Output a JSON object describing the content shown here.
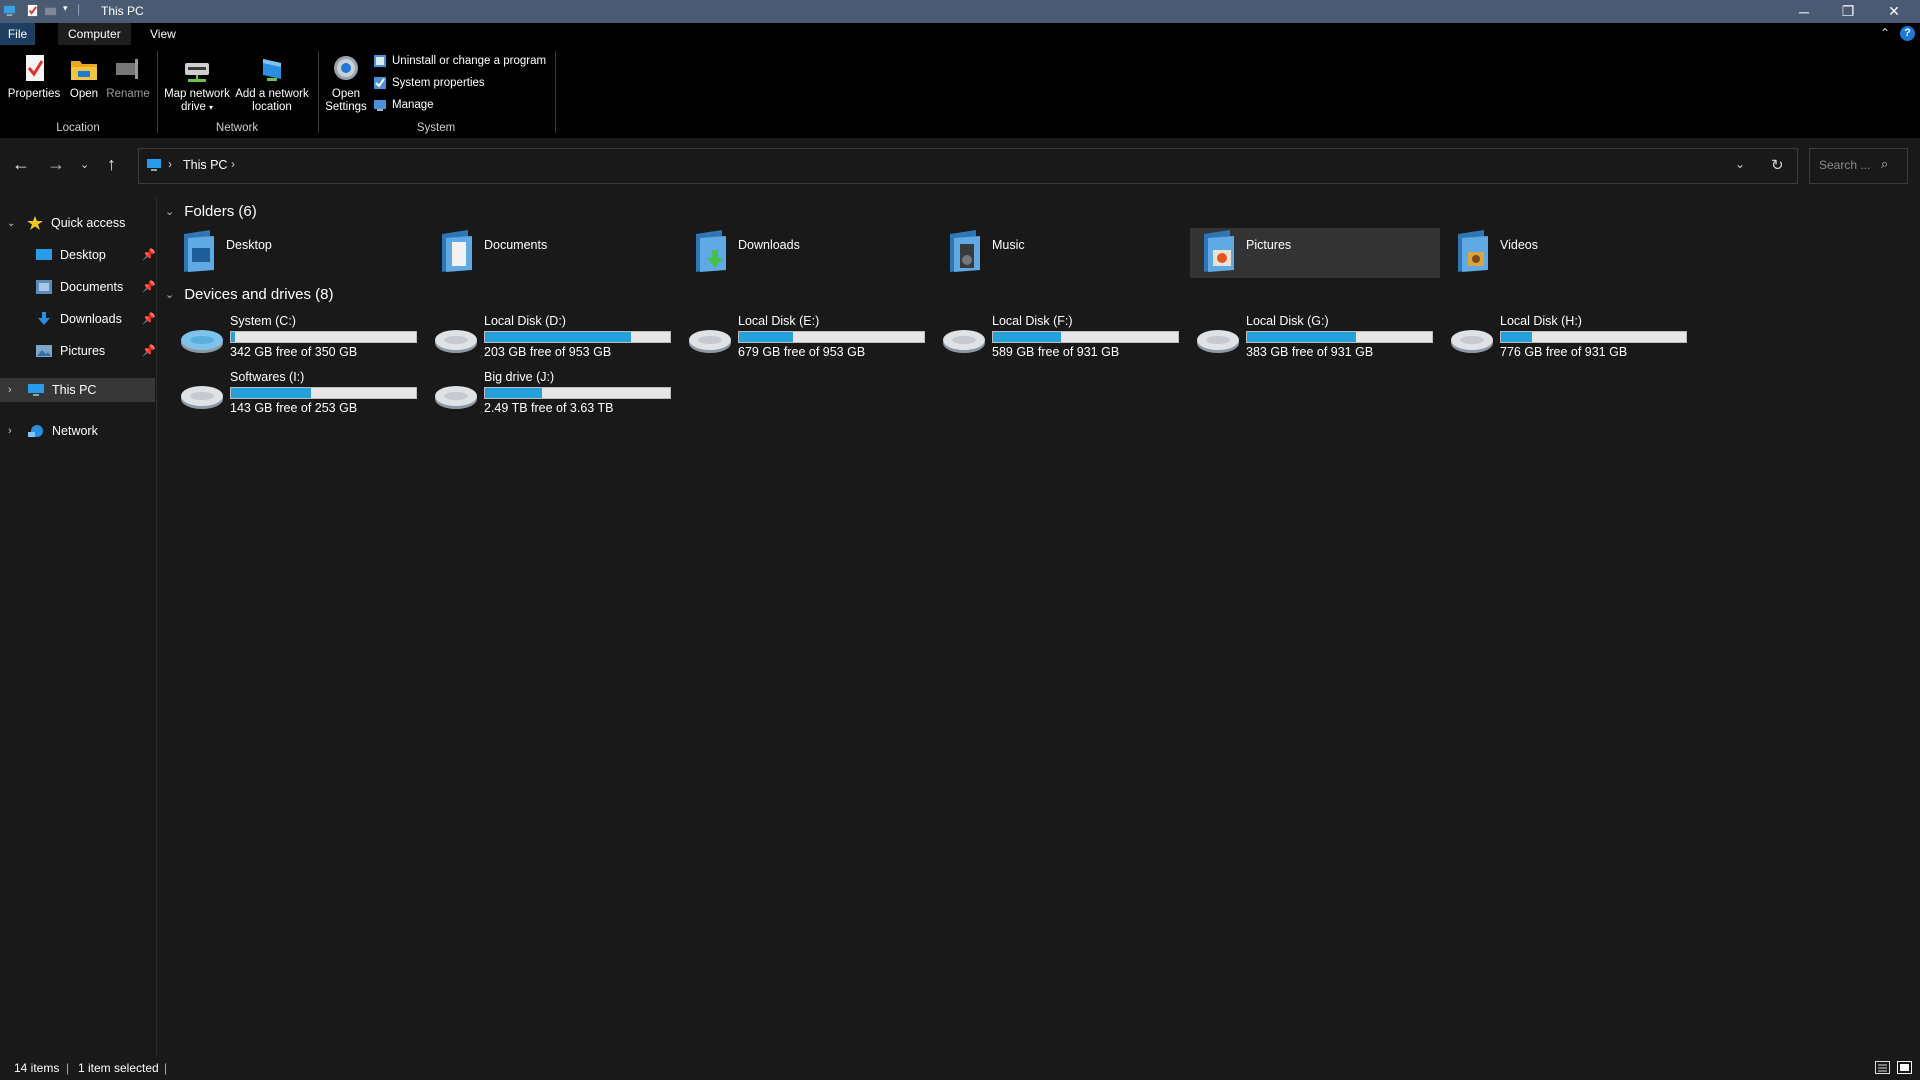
{
  "window": {
    "title": "This PC",
    "controls": [
      "minimize",
      "restore",
      "close"
    ]
  },
  "ribbon": {
    "tabs": [
      {
        "label": "File"
      },
      {
        "label": "Computer",
        "active": true
      },
      {
        "label": "View"
      }
    ],
    "location_group": {
      "label": "Location",
      "buttons": [
        {
          "label": "Properties",
          "icon": "properties-icon"
        },
        {
          "label": "Open",
          "icon": "open-folder-icon"
        },
        {
          "label": "Rename",
          "icon": "rename-icon"
        }
      ]
    },
    "network_group": {
      "label": "Network",
      "map_drive_line1": "Map network",
      "map_drive_line2": "drive",
      "add_location_line1": "Add a network",
      "add_location_line2": "location"
    },
    "system_group": {
      "label": "System",
      "open_settings_line1": "Open",
      "open_settings_line2": "Settings",
      "uninstall": "Uninstall or change a program",
      "system_properties": "System properties",
      "manage": "Manage"
    }
  },
  "address": {
    "location": "This PC",
    "search_placeholder": "Search ..."
  },
  "nav_pane": {
    "quick_access": "Quick access",
    "pinned": [
      {
        "label": "Desktop",
        "icon": "desktop-icon"
      },
      {
        "label": "Documents",
        "icon": "documents-icon"
      },
      {
        "label": "Downloads",
        "icon": "downloads-icon"
      },
      {
        "label": "Pictures",
        "icon": "pictures-icon"
      }
    ],
    "this_pc": "This PC",
    "network": "Network"
  },
  "content": {
    "folders_header": "Folders (6)",
    "folders": [
      {
        "label": "Desktop",
        "icon": "desktop-folder-icon"
      },
      {
        "label": "Documents",
        "icon": "documents-folder-icon"
      },
      {
        "label": "Downloads",
        "icon": "downloads-folder-icon"
      },
      {
        "label": "Music",
        "icon": "music-folder-icon"
      },
      {
        "label": "Pictures",
        "icon": "pictures-folder-icon",
        "selected": true
      },
      {
        "label": "Videos",
        "icon": "videos-folder-icon"
      }
    ],
    "drives_header": "Devices and drives (8)",
    "drives": [
      {
        "name": "System (C:)",
        "free": "342 GB free of 350 GB",
        "used_fraction": 0.02
      },
      {
        "name": "Local Disk (D:)",
        "free": "203 GB free of 953 GB",
        "used_fraction": 0.79
      },
      {
        "name": "Local Disk (E:)",
        "free": "679 GB free of 953 GB",
        "used_fraction": 0.29
      },
      {
        "name": "Local Disk (F:)",
        "free": "589 GB free of 931 GB",
        "used_fraction": 0.37
      },
      {
        "name": "Local Disk (G:)",
        "free": "383 GB free of 931 GB",
        "used_fraction": 0.59
      },
      {
        "name": "Local Disk (H:)",
        "free": "776 GB free of 931 GB",
        "used_fraction": 0.17
      },
      {
        "name": "Softwares (I:)",
        "free": "143 GB free of 253 GB",
        "used_fraction": 0.43
      },
      {
        "name": "Big drive (J:)",
        "free": "2.49 TB free of 3.63 TB",
        "used_fraction": 0.31
      }
    ]
  },
  "status": {
    "items": "14 items",
    "selected": "1 item selected"
  },
  "colors": {
    "background": "#191919",
    "titlebar": "#4a5a72",
    "accent": "#26a0da",
    "selection": "#333333"
  }
}
